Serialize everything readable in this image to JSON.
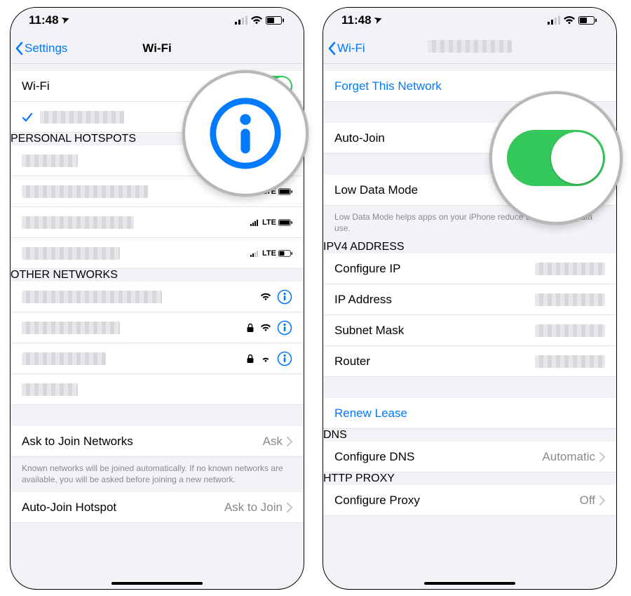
{
  "status": {
    "time": "11:48",
    "location_glyph": "➤"
  },
  "left": {
    "nav": {
      "back": "Settings",
      "title": "Wi-Fi"
    },
    "wifi_row": {
      "label": "Wi-Fi"
    },
    "sections": {
      "hotspots_header": "PERSONAL HOTSPOTS",
      "other_header": "OTHER NETWORKS"
    },
    "lte_tag": "LTE",
    "ask_join": {
      "label": "Ask to Join Networks",
      "value": "Ask"
    },
    "ask_footer": "Known networks will be joined automatically. If no known networks are available, you will be asked before joining a new network.",
    "autojoin_hotspot": {
      "label": "Auto-Join Hotspot",
      "value": "Ask to Join"
    }
  },
  "right": {
    "nav": {
      "back": "Wi-Fi"
    },
    "forget": "Forget This Network",
    "autojoin": "Auto-Join",
    "lowdata": {
      "label": "Low Data Mode",
      "footer": "Low Data Mode helps apps on your iPhone reduce their network data use."
    },
    "ipv4_header": "IPV4 ADDRESS",
    "ipv4": {
      "configure": "Configure IP",
      "ip": "IP Address",
      "subnet": "Subnet Mask",
      "router": "Router"
    },
    "renew": "Renew Lease",
    "dns_header": "DNS",
    "dns": {
      "label": "Configure DNS",
      "value": "Automatic"
    },
    "http_header": "HTTP PROXY",
    "proxy": {
      "label": "Configure Proxy",
      "value": "Off"
    }
  }
}
